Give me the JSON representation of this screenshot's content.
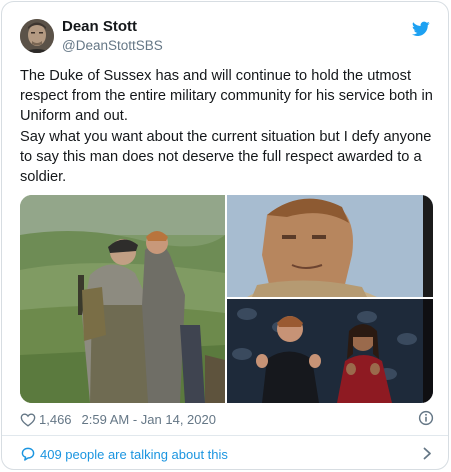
{
  "author": {
    "name": "Dean Stott",
    "handle": "@DeanStottSBS",
    "avatar_icon": "profile-photo"
  },
  "brand_icon": "twitter-bird-icon",
  "colors": {
    "brand": "#1da1f2",
    "link": "#1b95e0",
    "text": "#14171a",
    "muted": "#657786",
    "border": "#d7dde2"
  },
  "tweet": {
    "paragraphs": [
      "The Duke of Sussex has and will continue to hold the utmost respect from the entire military community for his service both in Uniform and out.",
      "Say what you want about the current situation but I defy anyone to say this man does not deserve the full respect awarded to a soldier."
    ]
  },
  "media": {
    "photos": [
      {
        "description_icon": "photo-soldiers-field"
      },
      {
        "description_icon": "photo-portrait-desert"
      },
      {
        "description_icon": "photo-couple-event"
      }
    ]
  },
  "meta": {
    "likes": "1,466",
    "timestamp": "2:59 AM - Jan 14, 2020",
    "info_icon": "info-icon",
    "like_icon": "heart-icon"
  },
  "footer": {
    "talking_label": "409 people are talking about this",
    "icon": "speech-bubble-icon",
    "chevron_icon": "chevron-right-icon"
  }
}
